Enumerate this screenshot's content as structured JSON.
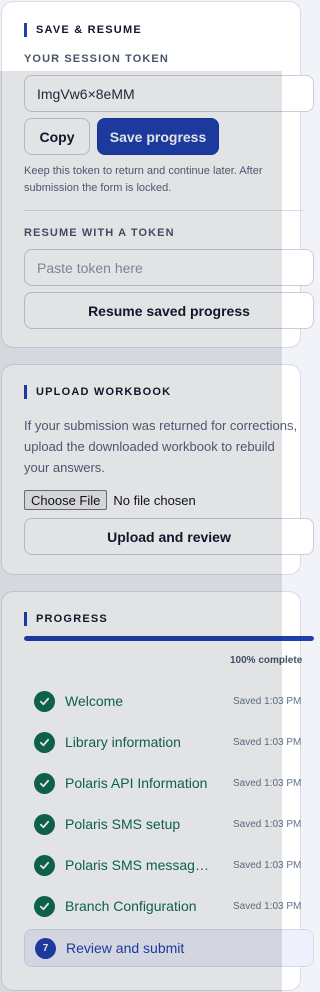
{
  "save_resume": {
    "title": "SAVE & RESUME",
    "token_label": "YOUR SESSION TOKEN",
    "token_value": "ImgVw6×8eMM",
    "copy_label": "Copy",
    "save_label": "Save progress",
    "help_line1": "Keep this token to return and continue later. After",
    "help_line2": "submission the form is locked.",
    "resume_label": "RESUME WITH A TOKEN",
    "resume_placeholder": "Paste token here",
    "resume_button": "Resume saved progress"
  },
  "upload": {
    "title": "UPLOAD WORKBOOK",
    "help_line1": "If your submission was returned for corrections,",
    "help_line2": "upload the downloaded workbook to rebuild",
    "help_line3": "your answers.",
    "choose_file": "Choose File",
    "no_file": "No file chosen",
    "upload_button": "Upload and review"
  },
  "progress": {
    "title": "PROGRESS",
    "percent": 100,
    "percent_label": "100% complete",
    "steps": [
      {
        "name": "Welcome",
        "saved": "Saved 1:03 PM",
        "status": "done"
      },
      {
        "name": "Library information",
        "saved": "Saved 1:03 PM",
        "status": "done"
      },
      {
        "name": "Polaris API Information",
        "saved": "Saved 1:03 PM",
        "status": "done"
      },
      {
        "name": "Polaris SMS setup",
        "saved": "Saved 1:03 PM",
        "status": "done"
      },
      {
        "name": "Polaris SMS messages & tokens",
        "saved": "Saved 1:03 PM",
        "status": "done"
      },
      {
        "name": "Branch Configuration",
        "saved": "Saved 1:03 PM",
        "status": "done"
      },
      {
        "name": "Review and submit",
        "number": "7",
        "status": "current"
      }
    ]
  },
  "colors": {
    "accent": "#1e3fae",
    "success": "#0e6b4d"
  }
}
